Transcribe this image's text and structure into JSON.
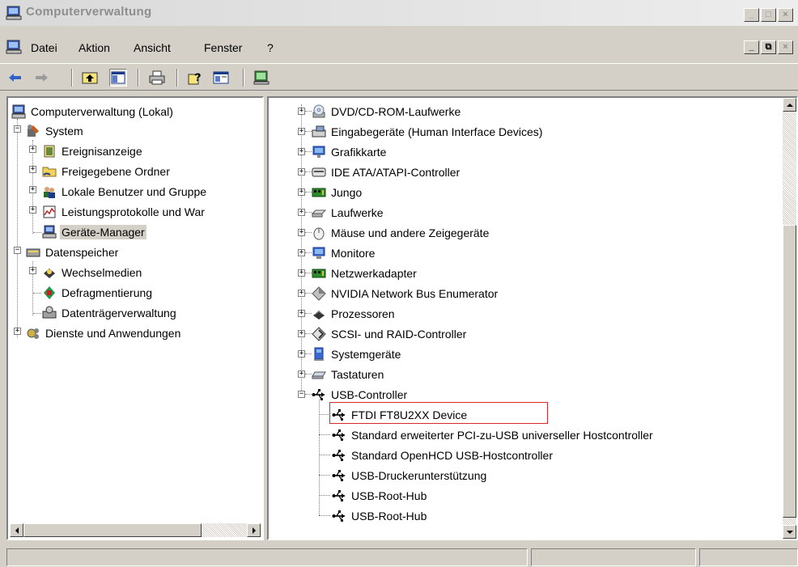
{
  "window": {
    "title": "Computerverwaltung"
  },
  "menu": {
    "items": [
      "Datei",
      "Aktion",
      "Ansicht",
      "Fenster",
      "?"
    ]
  },
  "toolbar": {
    "buttons": [
      "back-arrow",
      "forward-arrow",
      "up-folder",
      "show-hide-tree",
      "print",
      "help",
      "properties",
      "console"
    ]
  },
  "left_tree": {
    "items": [
      {
        "label": "Computerverwaltung (Lokal)",
        "icon": "computer-icon"
      },
      {
        "label": "System",
        "icon": "system-tools-icon"
      },
      {
        "label": "Ereignisanzeige",
        "icon": "event-viewer-icon"
      },
      {
        "label": "Freigegebene Ordner",
        "icon": "shared-folder-icon"
      },
      {
        "label": "Lokale Benutzer und Gruppe",
        "icon": "users-icon"
      },
      {
        "label": "Leistungsprotokolle und War",
        "icon": "performance-icon"
      },
      {
        "label": "Geräte-Manager",
        "icon": "device-manager-icon",
        "selected": true
      },
      {
        "label": "Datenspeicher",
        "icon": "storage-icon"
      },
      {
        "label": "Wechselmedien",
        "icon": "removable-media-icon"
      },
      {
        "label": "Defragmentierung",
        "icon": "defrag-icon"
      },
      {
        "label": "Datenträgerverwaltung",
        "icon": "disk-management-icon"
      },
      {
        "label": "Dienste und Anwendungen",
        "icon": "services-icon"
      }
    ]
  },
  "right_tree": {
    "items": [
      {
        "label": "DVD/CD-ROM-Laufwerke",
        "icon": "cdrom-icon"
      },
      {
        "label": "Eingabegeräte (Human Interface Devices)",
        "icon": "hid-icon"
      },
      {
        "label": "Grafikkarte",
        "icon": "display-adapter-icon"
      },
      {
        "label": "IDE ATA/ATAPI-Controller",
        "icon": "ide-controller-icon"
      },
      {
        "label": "Jungo",
        "icon": "jungo-board-icon"
      },
      {
        "label": "Laufwerke",
        "icon": "disk-drive-icon"
      },
      {
        "label": "Mäuse und andere Zeigegeräte",
        "icon": "mouse-icon"
      },
      {
        "label": "Monitore",
        "icon": "monitor-icon"
      },
      {
        "label": "Netzwerkadapter",
        "icon": "network-adapter-icon"
      },
      {
        "label": "NVIDIA Network Bus Enumerator",
        "icon": "nvidia-bus-icon"
      },
      {
        "label": "Prozessoren",
        "icon": "processor-icon"
      },
      {
        "label": "SCSI- und RAID-Controller",
        "icon": "scsi-controller-icon"
      },
      {
        "label": "Systemgeräte",
        "icon": "system-devices-icon"
      },
      {
        "label": "Tastaturen",
        "icon": "keyboard-icon"
      },
      {
        "label": "USB-Controller",
        "icon": "usb-icon"
      }
    ],
    "usb_children": [
      {
        "label": "FTDI FT8U2XX Device",
        "icon": "usb-icon",
        "highlighted": true
      },
      {
        "label": "Standard erweiterter PCI-zu-USB universeller Hostcontroller",
        "icon": "usb-icon"
      },
      {
        "label": "Standard OpenHCD USB-Hostcontroller",
        "icon": "usb-icon"
      },
      {
        "label": "USB-Druckerunterstützung",
        "icon": "usb-icon"
      },
      {
        "label": "USB-Root-Hub",
        "icon": "usb-icon"
      },
      {
        "label": "USB-Root-Hub",
        "icon": "usb-icon"
      }
    ]
  },
  "colors": {
    "highlight_box": "#d42a2a",
    "window_face": "#d4d0c8"
  }
}
